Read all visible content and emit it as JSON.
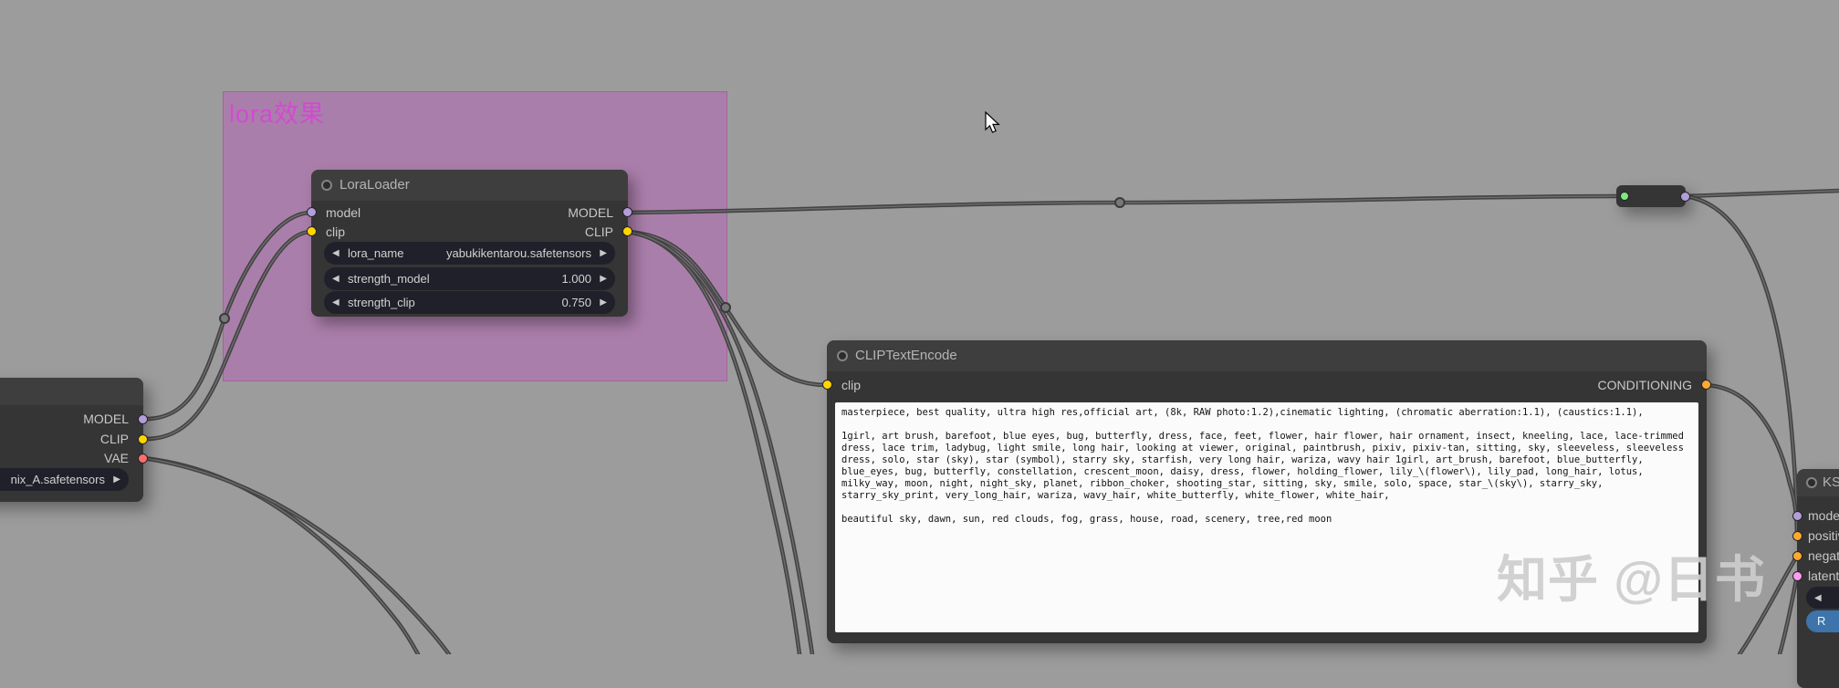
{
  "icons": {
    "arrow_left": "◀",
    "arrow_right": "▶"
  },
  "colors": {
    "model": "background:#b39ddb",
    "clip": "background:#ffd500",
    "vae": "background:#ff6e6e",
    "conditioning": "background:#ffa931",
    "latent": "background:#ff9cf0",
    "green": "background:#7fe87f"
  },
  "group": {
    "title": "lora效果"
  },
  "checkpoint_node": {
    "outputs": [
      {
        "label": "MODEL"
      },
      {
        "label": "CLIP"
      },
      {
        "label": "VAE"
      }
    ],
    "widget_value": "nix_A.safetensors"
  },
  "lora_node": {
    "title": "LoraLoader",
    "input_model": "model",
    "input_clip": "clip",
    "output_model": "MODEL",
    "output_clip": "CLIP",
    "widgets": {
      "lora_name_label": "lora_name",
      "lora_name_value": "yabukikentarou.safetensors",
      "strength_model_label": "strength_model",
      "strength_model_value": "1.000",
      "strength_clip_label": "strength_clip",
      "strength_clip_value": "0.750"
    }
  },
  "encode_node": {
    "title": "CLIPTextEncode",
    "input": "clip",
    "output": "CONDITIONING",
    "prompt_p1": "masterpiece, best quality, ultra high res,official art, (8k, RAW photo:1.2),cinematic lighting, (chromatic aberration:1.1), (caustics:1.1),",
    "prompt_p2": "1girl, art brush, barefoot, blue eyes, bug, butterfly, dress, face, feet, flower, hair flower, hair ornament, insect, kneeling, lace, lace-trimmed dress, lace trim, ladybug, light smile, long hair, looking at viewer, original, paintbrush, pixiv, pixiv-tan, sitting, sky, sleeveless, sleeveless dress, solo, star (sky), star (symbol), starry sky, starfish, very long hair, wariza, wavy hair 1girl, art_brush, barefoot, blue_butterfly, blue_eyes, bug, butterfly, constellation, crescent_moon, daisy, dress, flower, holding_flower, lily_\\(flower\\), lily_pad, long_hair, lotus, milky_way, moon, night, night_sky, planet, ribbon_choker, shooting_star, sitting, sky, smile, solo, space, star_\\(sky\\), starry_sky, starry_sky_print, very_long_hair, wariza, wavy_hair, white_butterfly, white_flower, white_hair,",
    "prompt_p3": "beautiful sky, dawn, sun, red clouds, fog, grass, house, road, scenery, tree,red moon"
  },
  "sampler_node": {
    "title": "KSampler",
    "inputs": [
      {
        "label": "model"
      },
      {
        "label": "positive"
      },
      {
        "label": "negative"
      },
      {
        "label": "latent_image"
      }
    ],
    "blue_widget": "R"
  },
  "watermark": "知乎 @日书"
}
